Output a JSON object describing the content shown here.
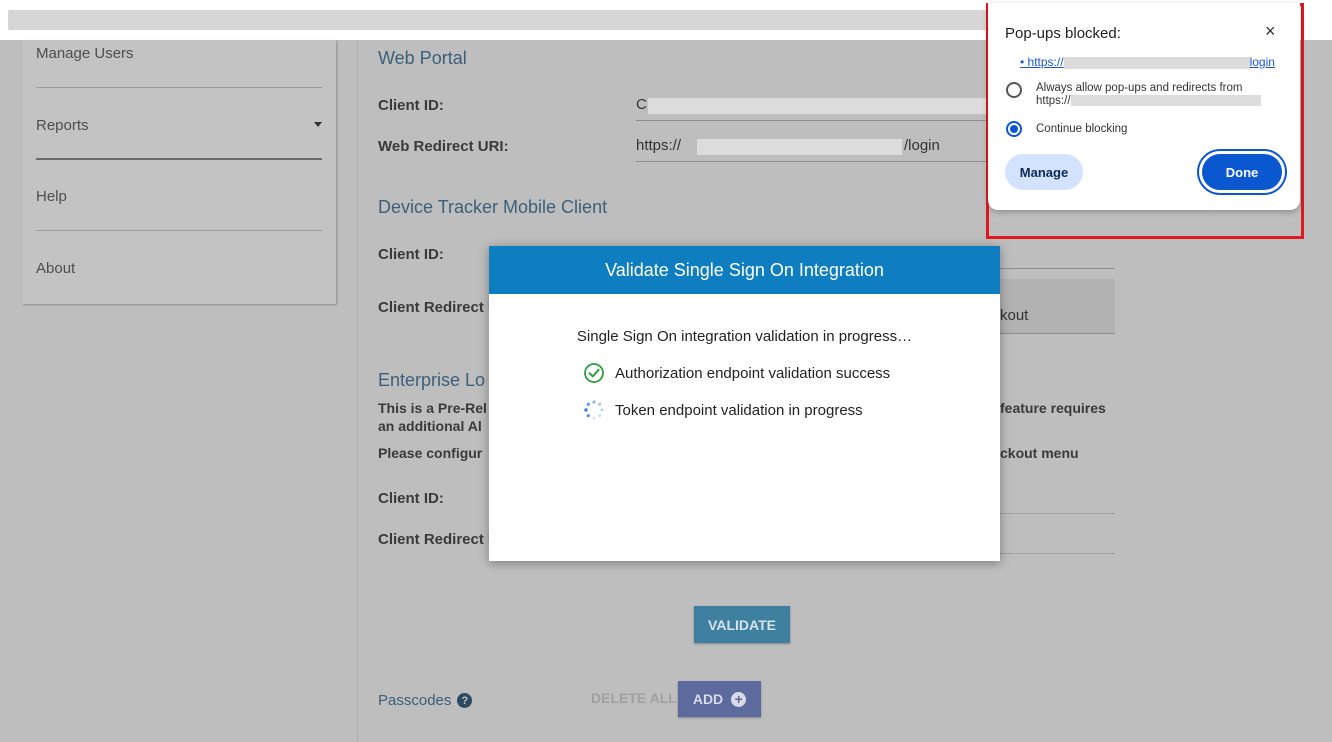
{
  "sidebar": {
    "items": [
      {
        "label": "Manage Users"
      },
      {
        "label": "Reports"
      },
      {
        "label": "Help"
      },
      {
        "label": "About"
      }
    ]
  },
  "web_portal": {
    "title": "Web Portal",
    "client_id_label": "Client ID:",
    "client_id_value": "C",
    "redirect_label": "Web Redirect URI:",
    "redirect_prefix": "https://",
    "redirect_suffix": "/login"
  },
  "mobile": {
    "title": "Device Tracker Mobile Client",
    "client_id_label": "Client ID:",
    "redirect_label": "Client Redirect U",
    "checkout_fragment": "kout"
  },
  "enterprise": {
    "title": "Enterprise Lo",
    "line1_start": "This is a Pre-Rel",
    "line1_end": "feature requires",
    "line2_start": "an additional Al",
    "line3_start": "Please configur",
    "line3_end": "ckout menu",
    "client_id_label": "Client ID:",
    "redirect_label": "Client Redirect U"
  },
  "buttons": {
    "validate": "VALIDATE",
    "delete_all": "DELETE ALL",
    "add": "ADD"
  },
  "passcodes": {
    "label": "Passcodes",
    "help": "?"
  },
  "modal": {
    "title": "Validate Single Sign On Integration",
    "progress_text": "Single Sign On integration validation in progress…",
    "step1": "Authorization endpoint validation success",
    "step2": "Token endpoint validation in progress"
  },
  "popup": {
    "title": "Pop-ups blocked:",
    "close": "×",
    "link_prefix": "• https://",
    "link_suffix": "login",
    "option_allow": "Always allow pop-ups and redirects from",
    "option_allow_url": "https://",
    "option_block": "Continue blocking",
    "selected": "Continue blocking",
    "manage": "Manage",
    "done": "Done"
  },
  "colors": {
    "modal_header": "#0e7ec0",
    "popup_frame": "#e0191f",
    "done_button": "#0b57d0",
    "success_check": "#2e9e3e"
  }
}
